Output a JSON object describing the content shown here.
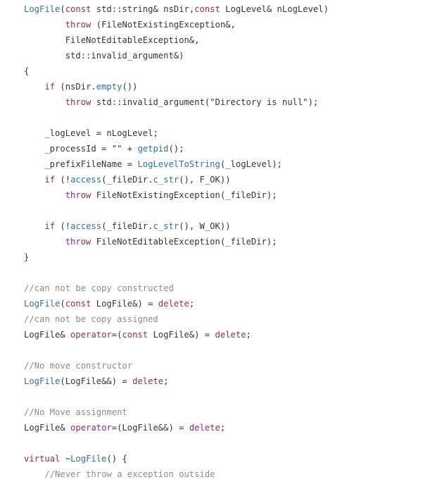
{
  "code": {
    "language": "cpp",
    "colors": {
      "keyword": "#8f2a5e",
      "function": "#2e6fa6",
      "comment": "#8a8a8a",
      "text": "#333333"
    },
    "lines": [
      [
        {
          "t": "fn",
          "v": "LogFile"
        },
        {
          "t": "tx",
          "v": "("
        },
        {
          "t": "kw",
          "v": "const"
        },
        {
          "t": "tx",
          "v": " std::string& nsDir,"
        },
        {
          "t": "kw",
          "v": "const"
        },
        {
          "t": "tx",
          "v": " LogLevel& nLogLevel)"
        }
      ],
      [
        {
          "t": "tx",
          "v": "        "
        },
        {
          "t": "kw",
          "v": "throw"
        },
        {
          "t": "tx",
          "v": " (FileNotExistingException&,"
        }
      ],
      [
        {
          "t": "tx",
          "v": "        FileNotEditableException&,"
        }
      ],
      [
        {
          "t": "tx",
          "v": "        std::invalid_argument&)"
        }
      ],
      [
        {
          "t": "tx",
          "v": "{"
        }
      ],
      [
        {
          "t": "tx",
          "v": "    "
        },
        {
          "t": "kw",
          "v": "if"
        },
        {
          "t": "tx",
          "v": " (nsDir."
        },
        {
          "t": "fn",
          "v": "empty"
        },
        {
          "t": "tx",
          "v": "())"
        }
      ],
      [
        {
          "t": "tx",
          "v": "        "
        },
        {
          "t": "kw",
          "v": "throw"
        },
        {
          "t": "tx",
          "v": " std::invalid_argument(\"Directory is null\");"
        }
      ],
      [],
      [
        {
          "t": "tx",
          "v": "    _logLevel = nLogLevel;"
        }
      ],
      [
        {
          "t": "tx",
          "v": "    _processId = \"\" + "
        },
        {
          "t": "fn",
          "v": "getpid"
        },
        {
          "t": "tx",
          "v": "();"
        }
      ],
      [
        {
          "t": "tx",
          "v": "    _prefixFileName = "
        },
        {
          "t": "fn",
          "v": "LogLevelToString"
        },
        {
          "t": "tx",
          "v": "(_logLevel);"
        }
      ],
      [
        {
          "t": "tx",
          "v": "    "
        },
        {
          "t": "kw",
          "v": "if"
        },
        {
          "t": "tx",
          "v": " (!"
        },
        {
          "t": "fn",
          "v": "access"
        },
        {
          "t": "tx",
          "v": "(_fileDir."
        },
        {
          "t": "fn",
          "v": "c_str"
        },
        {
          "t": "tx",
          "v": "(), F_OK))"
        }
      ],
      [
        {
          "t": "tx",
          "v": "        "
        },
        {
          "t": "kw",
          "v": "throw"
        },
        {
          "t": "tx",
          "v": " FileNotExistingException(_fileDir);"
        }
      ],
      [],
      [
        {
          "t": "tx",
          "v": "    "
        },
        {
          "t": "kw",
          "v": "if"
        },
        {
          "t": "tx",
          "v": " (!"
        },
        {
          "t": "fn",
          "v": "access"
        },
        {
          "t": "tx",
          "v": "(_fileDir."
        },
        {
          "t": "fn",
          "v": "c_str"
        },
        {
          "t": "tx",
          "v": "(), W_OK))"
        }
      ],
      [
        {
          "t": "tx",
          "v": "        "
        },
        {
          "t": "kw",
          "v": "throw"
        },
        {
          "t": "tx",
          "v": " FileNotEditableException(_fileDir);"
        }
      ],
      [
        {
          "t": "tx",
          "v": "}"
        }
      ],
      [],
      [
        {
          "t": "cm",
          "v": "//can not be copy constructed"
        }
      ],
      [
        {
          "t": "fn",
          "v": "LogFile"
        },
        {
          "t": "tx",
          "v": "("
        },
        {
          "t": "kw",
          "v": "const"
        },
        {
          "t": "tx",
          "v": " LogFile&) = "
        },
        {
          "t": "kw",
          "v": "delete"
        },
        {
          "t": "tx",
          "v": ";"
        }
      ],
      [
        {
          "t": "cm",
          "v": "//can not be copy assigned"
        }
      ],
      [
        {
          "t": "tx",
          "v": "LogFile& "
        },
        {
          "t": "kw",
          "v": "operator"
        },
        {
          "t": "tx",
          "v": "=("
        },
        {
          "t": "kw",
          "v": "const"
        },
        {
          "t": "tx",
          "v": " LogFile&) = "
        },
        {
          "t": "kw",
          "v": "delete"
        },
        {
          "t": "tx",
          "v": ";"
        }
      ],
      [],
      [
        {
          "t": "cm",
          "v": "//No move constructor"
        }
      ],
      [
        {
          "t": "fn",
          "v": "LogFile"
        },
        {
          "t": "tx",
          "v": "(LogFile&&) = "
        },
        {
          "t": "kw",
          "v": "delete"
        },
        {
          "t": "tx",
          "v": ";"
        }
      ],
      [],
      [
        {
          "t": "cm",
          "v": "//No Move assignment"
        }
      ],
      [
        {
          "t": "tx",
          "v": "LogFile& "
        },
        {
          "t": "kw",
          "v": "operator"
        },
        {
          "t": "tx",
          "v": "=(LogFile&&) = "
        },
        {
          "t": "kw",
          "v": "delete"
        },
        {
          "t": "tx",
          "v": ";"
        }
      ],
      [],
      [
        {
          "t": "kw",
          "v": "virtual"
        },
        {
          "t": "tx",
          "v": " ~"
        },
        {
          "t": "fn",
          "v": "LogFile"
        },
        {
          "t": "tx",
          "v": "() {"
        }
      ],
      [
        {
          "t": "tx",
          "v": "    "
        },
        {
          "t": "cm",
          "v": "//Never throw a exception outside"
        }
      ]
    ]
  }
}
